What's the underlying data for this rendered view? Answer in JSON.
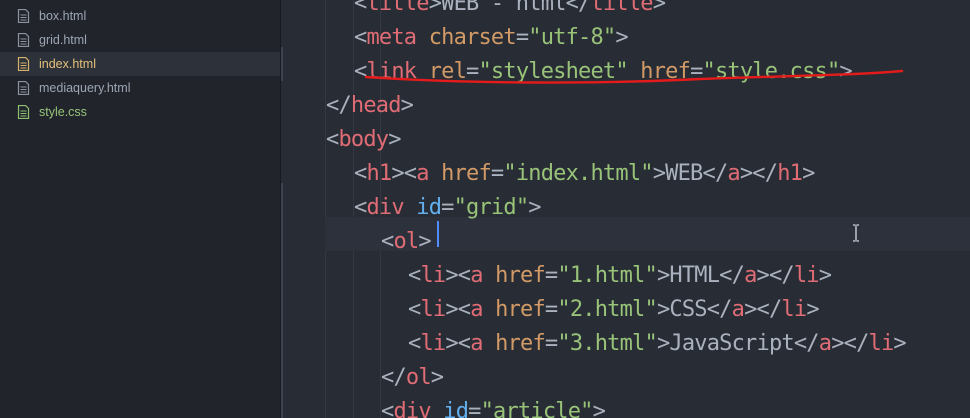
{
  "tree_view": {
    "files": [
      {
        "name": "box.html",
        "color": "#9da5b4",
        "selected": false
      },
      {
        "name": "grid.html",
        "color": "#9da5b4",
        "selected": false
      },
      {
        "name": "index.html",
        "color": "#e5c07b",
        "selected": true
      },
      {
        "name": "mediaquery.html",
        "color": "#9da5b4",
        "selected": false
      },
      {
        "name": "style.css",
        "color": "#98c379",
        "selected": false
      }
    ]
  },
  "editor": {
    "language": "html",
    "theme_colors": {
      "background": "#282c34",
      "tag": "#e06c75",
      "attribute": "#d19a66",
      "string": "#98c379",
      "text": "#abb2bf",
      "id_attribute": "#61afef",
      "annotation_underline": "#e51b1b"
    },
    "lines": [
      {
        "tokens": [
          [
            "pun",
            "<"
          ],
          [
            "tag",
            "title"
          ],
          [
            "pun",
            ">"
          ],
          [
            "txt",
            "WEB - html"
          ],
          [
            "pun",
            "</"
          ],
          [
            "tag",
            "title"
          ],
          [
            "pun",
            ">"
          ]
        ]
      },
      {
        "tokens": [
          [
            "pun",
            "<"
          ],
          [
            "tag",
            "meta"
          ],
          [
            "pun",
            " "
          ],
          [
            "att",
            "charset"
          ],
          [
            "pun",
            "="
          ],
          [
            "val",
            "\"utf-8\""
          ],
          [
            "pun",
            ">"
          ]
        ]
      },
      {
        "tokens": [
          [
            "pun",
            "<"
          ],
          [
            "tag",
            "link"
          ],
          [
            "pun",
            " "
          ],
          [
            "att",
            "rel"
          ],
          [
            "pun",
            "="
          ],
          [
            "val",
            "\"stylesheet\""
          ],
          [
            "pun",
            " "
          ],
          [
            "att",
            "href"
          ],
          [
            "pun",
            "="
          ],
          [
            "val",
            "\"style.css\""
          ],
          [
            "pun",
            ">"
          ]
        ]
      },
      {
        "tokens": [
          [
            "pun",
            "</"
          ],
          [
            "tag",
            "head"
          ],
          [
            "pun",
            ">"
          ]
        ]
      },
      {
        "tokens": [
          [
            "pun",
            "<"
          ],
          [
            "tag",
            "body"
          ],
          [
            "pun",
            ">"
          ]
        ]
      },
      {
        "tokens": [
          [
            "pun",
            "<"
          ],
          [
            "tag",
            "h1"
          ],
          [
            "pun",
            "><"
          ],
          [
            "tag",
            "a"
          ],
          [
            "pun",
            " "
          ],
          [
            "att",
            "href"
          ],
          [
            "pun",
            "="
          ],
          [
            "val",
            "\"index.html\""
          ],
          [
            "pun",
            ">"
          ],
          [
            "txt",
            "WEB"
          ],
          [
            "pun",
            "</"
          ],
          [
            "tag",
            "a"
          ],
          [
            "pun",
            "></"
          ],
          [
            "tag",
            "h1"
          ],
          [
            "pun",
            ">"
          ]
        ]
      },
      {
        "tokens": [
          [
            "pun",
            "<"
          ],
          [
            "tag",
            "div"
          ],
          [
            "pun",
            " "
          ],
          [
            "id",
            "id"
          ],
          [
            "pun",
            "="
          ],
          [
            "val",
            "\"grid\""
          ],
          [
            "pun",
            ">"
          ]
        ]
      },
      {
        "tokens": [
          [
            "pun",
            "<"
          ],
          [
            "tag",
            "ol"
          ],
          [
            "pun",
            ">"
          ]
        ]
      },
      {
        "tokens": [
          [
            "pun",
            "<"
          ],
          [
            "tag",
            "li"
          ],
          [
            "pun",
            "><"
          ],
          [
            "tag",
            "a"
          ],
          [
            "pun",
            " "
          ],
          [
            "att",
            "href"
          ],
          [
            "pun",
            "="
          ],
          [
            "val",
            "\"1.html\""
          ],
          [
            "pun",
            ">"
          ],
          [
            "txt",
            "HTML"
          ],
          [
            "pun",
            "</"
          ],
          [
            "tag",
            "a"
          ],
          [
            "pun",
            "></"
          ],
          [
            "tag",
            "li"
          ],
          [
            "pun",
            ">"
          ]
        ]
      },
      {
        "tokens": [
          [
            "pun",
            "<"
          ],
          [
            "tag",
            "li"
          ],
          [
            "pun",
            "><"
          ],
          [
            "tag",
            "a"
          ],
          [
            "pun",
            " "
          ],
          [
            "att",
            "href"
          ],
          [
            "pun",
            "="
          ],
          [
            "val",
            "\"2.html\""
          ],
          [
            "pun",
            ">"
          ],
          [
            "txt",
            "CSS"
          ],
          [
            "pun",
            "</"
          ],
          [
            "tag",
            "a"
          ],
          [
            "pun",
            "></"
          ],
          [
            "tag",
            "li"
          ],
          [
            "pun",
            ">"
          ]
        ]
      },
      {
        "tokens": [
          [
            "pun",
            "<"
          ],
          [
            "tag",
            "li"
          ],
          [
            "pun",
            "><"
          ],
          [
            "tag",
            "a"
          ],
          [
            "pun",
            " "
          ],
          [
            "att",
            "href"
          ],
          [
            "pun",
            "="
          ],
          [
            "val",
            "\"3.html\""
          ],
          [
            "pun",
            ">"
          ],
          [
            "txt",
            "JavaScript"
          ],
          [
            "pun",
            "</"
          ],
          [
            "tag",
            "a"
          ],
          [
            "pun",
            "></"
          ],
          [
            "tag",
            "li"
          ],
          [
            "pun",
            ">"
          ]
        ]
      },
      {
        "tokens": [
          [
            "pun",
            "</"
          ],
          [
            "tag",
            "ol"
          ],
          [
            "pun",
            ">"
          ]
        ]
      },
      {
        "tokens": [
          [
            "pun",
            "<"
          ],
          [
            "tag",
            "div"
          ],
          [
            "pun",
            " "
          ],
          [
            "id",
            "id"
          ],
          [
            "pun",
            "="
          ],
          [
            "val",
            "\"article\""
          ],
          [
            "pun",
            ">"
          ]
        ]
      }
    ]
  }
}
